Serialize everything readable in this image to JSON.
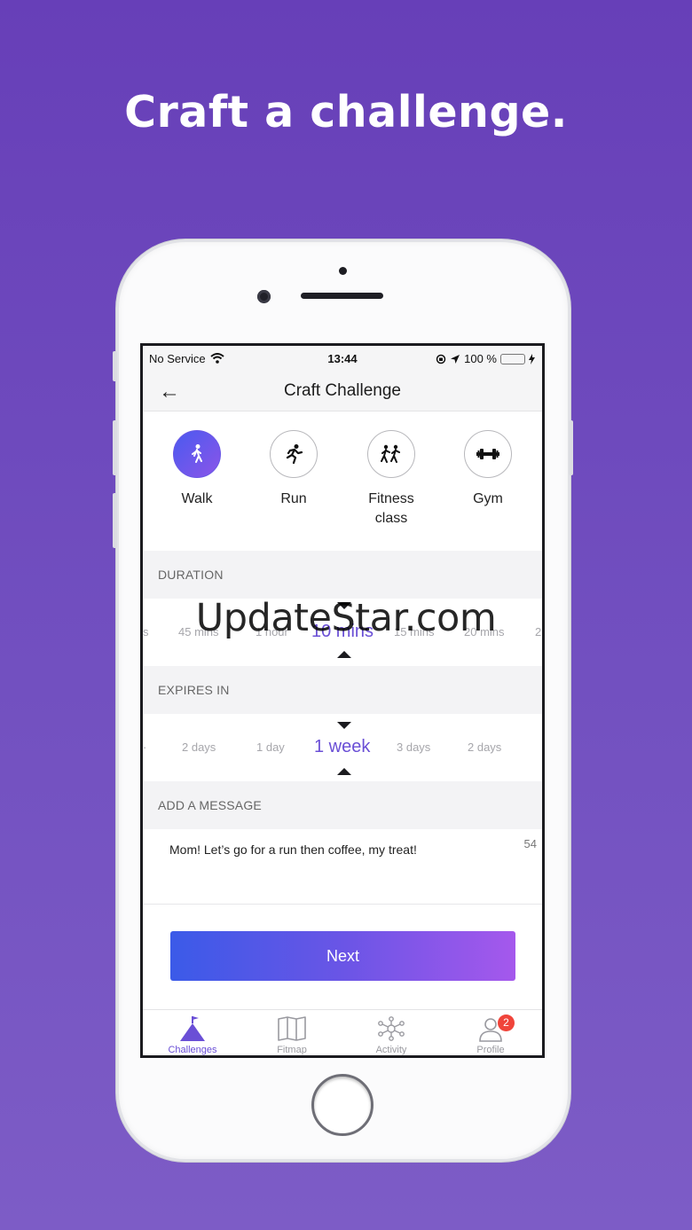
{
  "headline": "Craft a challenge.",
  "status_bar": {
    "carrier": "No Service",
    "time": "13:44",
    "battery": "100 %"
  },
  "nav": {
    "title": "Craft Challenge",
    "back_glyph": "←"
  },
  "activities": [
    {
      "label": "Walk",
      "icon": "walk-icon",
      "selected": true
    },
    {
      "label": "Run",
      "icon": "run-icon",
      "selected": false
    },
    {
      "label": "Fitness class",
      "icon": "fitness-class-icon",
      "selected": false
    },
    {
      "label": "Gym",
      "icon": "dumbbell-icon",
      "selected": false
    }
  ],
  "duration": {
    "heading": "DURATION",
    "options": [
      "s",
      "45 mins",
      "1 hour",
      "10 mins",
      "15 mins",
      "20 mins",
      "2"
    ],
    "selected": "10 mins"
  },
  "expires": {
    "heading": "EXPIRES IN",
    "options": [
      "2 days",
      "1 day",
      "1 week",
      "3 days",
      "2 days"
    ],
    "selected": "1 week"
  },
  "message": {
    "heading": "ADD A MESSAGE",
    "value": "Mom! Let’s go for a run then coffee, my treat!",
    "remaining": "54"
  },
  "next_button": "Next",
  "tabs": [
    {
      "label": "Challenges",
      "icon": "mountain-flag-icon",
      "active": true
    },
    {
      "label": "Fitmap",
      "icon": "map-icon",
      "active": false
    },
    {
      "label": "Activity",
      "icon": "network-icon",
      "active": false
    },
    {
      "label": "Profile",
      "icon": "person-icon",
      "active": false,
      "badge": "2"
    }
  ],
  "watermark": "UpdateStar.com",
  "colors": {
    "background": "#6b45bb",
    "accent": "#6a4fd6",
    "button_start": "#3b5ae8",
    "button_end": "#a558ec",
    "badge": "#f0443a"
  }
}
